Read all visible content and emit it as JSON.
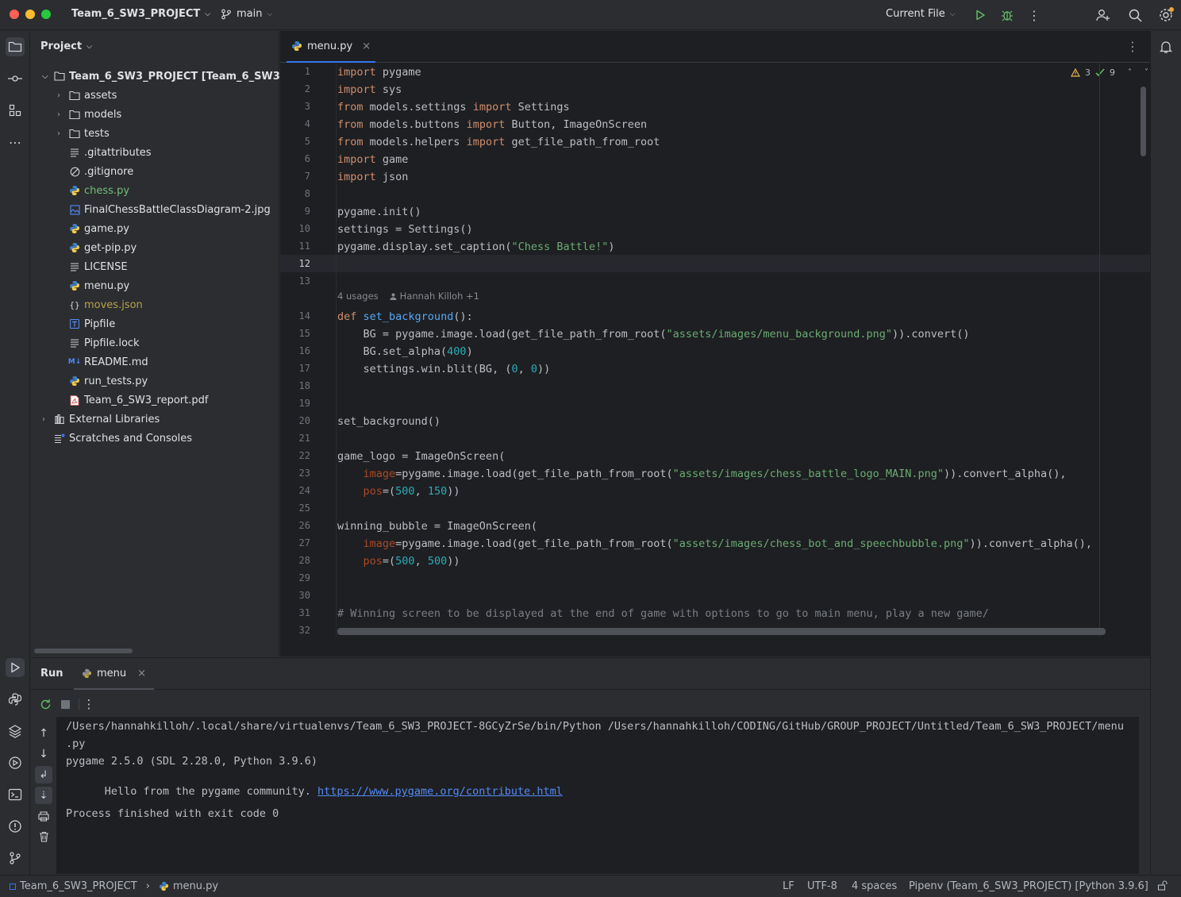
{
  "titlebar": {
    "project": "Team_6_SW3_PROJECT",
    "branch": "main",
    "run_config": "Current File"
  },
  "project_panel": {
    "title": "Project",
    "root": "Team_6_SW3_PROJECT [Team_6_SW3]",
    "items": [
      {
        "label": "assets",
        "type": "folder"
      },
      {
        "label": "models",
        "type": "folder"
      },
      {
        "label": "tests",
        "type": "folder"
      },
      {
        "label": ".gitattributes",
        "type": "text"
      },
      {
        "label": ".gitignore",
        "type": "ignore"
      },
      {
        "label": "chess.py",
        "type": "python",
        "color": "#73bd79"
      },
      {
        "label": "FinalChessBattleClassDiagram-2.jpg",
        "type": "image"
      },
      {
        "label": "game.py",
        "type": "python"
      },
      {
        "label": "get-pip.py",
        "type": "python"
      },
      {
        "label": "LICENSE",
        "type": "text"
      },
      {
        "label": "menu.py",
        "type": "python"
      },
      {
        "label": "moves.json",
        "type": "json",
        "color": "#b8a24a"
      },
      {
        "label": "Pipfile",
        "type": "toml"
      },
      {
        "label": "Pipfile.lock",
        "type": "text"
      },
      {
        "label": "README.md",
        "type": "markdown"
      },
      {
        "label": "run_tests.py",
        "type": "python"
      },
      {
        "label": "Team_6_SW3_report.pdf",
        "type": "pdf"
      }
    ],
    "external": "External Libraries",
    "scratches": "Scratches and Consoles"
  },
  "editor": {
    "tab": "menu.py",
    "warnings": "3",
    "checks": "9",
    "usages": "4 usages",
    "author": "Hannah Killoh +1",
    "line_numbers": [
      "1",
      "2",
      "3",
      "4",
      "5",
      "6",
      "7",
      "8",
      "9",
      "10",
      "11",
      "12",
      "13",
      "14",
      "15",
      "16",
      "17",
      "18",
      "19",
      "20",
      "21",
      "22",
      "23",
      "24",
      "25",
      "26",
      "27",
      "28",
      "29",
      "30",
      "31",
      "32"
    ]
  },
  "code": {
    "l1a": "import",
    "l1b": " pygame",
    "l2a": "import",
    "l2b": " sys",
    "l3a": "from",
    "l3b": " models.settings ",
    "l3c": "import",
    "l3d": " Settings",
    "l4a": "from",
    "l4b": " models.buttons ",
    "l4c": "import",
    "l4d": " Button, ImageOnScreen",
    "l5a": "from",
    "l5b": " models.helpers ",
    "l5c": "import",
    "l5d": " get_file_path_from_root",
    "l6a": "import",
    "l6b": " game",
    "l7a": "import",
    "l7b": " json",
    "l9": "pygame.init()",
    "l10": "settings = Settings()",
    "l11a": "pygame.display.set_caption(",
    "l11b": "\"Chess Battle!\"",
    "l11c": ")",
    "l14a": "def",
    "l14b": " ",
    "l14c": "set_background",
    "l14d": "():",
    "l15a": "    BG = pygame.image.load(get_file_path_from_root(",
    "l15b": "\"assets/images/menu_background.png\"",
    "l15c": ")).convert()",
    "l16a": "    BG.set_alpha(",
    "l16b": "400",
    "l16c": ")",
    "l17a": "    settings.win.blit(BG, (",
    "l17b": "0",
    "l17c": ", ",
    "l17d": "0",
    "l17e": "))",
    "l20": "set_background()",
    "l22": "game_logo = ImageOnScreen(",
    "l23a": "    ",
    "l23b": "image",
    "l23c": "=pygame.image.load(get_file_path_from_root(",
    "l23d": "\"assets/images/chess_battle_logo_MAIN.png\"",
    "l23e": ")).convert_alpha(),",
    "l24a": "    ",
    "l24b": "pos",
    "l24c": "=(",
    "l24d": "500",
    "l24e": ", ",
    "l24f": "150",
    "l24g": "))",
    "l26": "winning_bubble = ImageOnScreen(",
    "l27a": "    ",
    "l27b": "image",
    "l27c": "=pygame.image.load(get_file_path_from_root(",
    "l27d": "\"assets/images/chess_bot_and_speechbubble.png\"",
    "l27e": ")).convert_alpha(),",
    "l28a": "    ",
    "l28b": "pos",
    "l28c": "=(",
    "l28d": "500",
    "l28e": ", ",
    "l28f": "500",
    "l28g": "))",
    "l31": "# Winning screen to be displayed at the end of game with options to go to main menu, play a new game/"
  },
  "run": {
    "title": "Run",
    "tab": "menu",
    "line1": "/Users/hannahkilloh/.local/share/virtualenvs/Team_6_SW3_PROJECT-8GCyZrSe/bin/Python /Users/hannahkilloh/CODING/GitHub/GROUP_PROJECT/Untitled/Team_6_SW3_PROJECT/menu",
    "line2": ".py",
    "line3": "pygame 2.5.0 (SDL 2.28.0, Python 3.9.6)",
    "line4": "Hello from the pygame community. ",
    "link": "https://www.pygame.org/contribute.html",
    "line5": "Process finished with exit code 0"
  },
  "statusbar": {
    "project": "Team_6_SW3_PROJECT",
    "file": "menu.py",
    "line_sep": "LF",
    "encoding": "UTF-8",
    "indent": "4 spaces",
    "interpreter": "Pipenv (Team_6_SW3_PROJECT) [Python 3.9.6]"
  }
}
